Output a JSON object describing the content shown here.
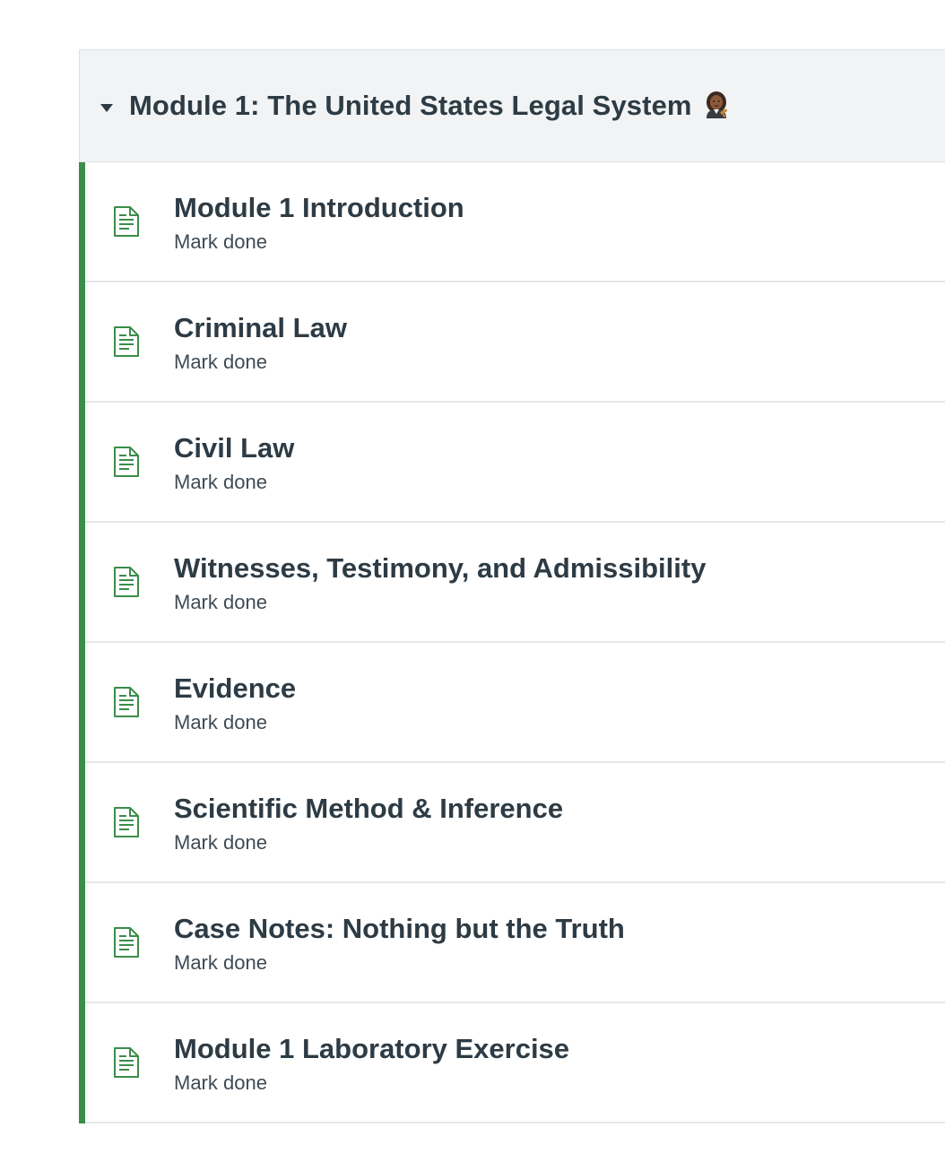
{
  "module": {
    "title": "Module 1: The United States Legal System",
    "emoji": "judge-woman-icon",
    "colors": {
      "accent": "#3b8d4a",
      "header_bg": "#f2f3f4",
      "text": "#2d3b45"
    },
    "items": [
      {
        "title": "Module 1 Introduction",
        "action": "Mark done",
        "icon": "page-icon"
      },
      {
        "title": "Criminal Law",
        "action": "Mark done",
        "icon": "page-icon"
      },
      {
        "title": "Civil Law",
        "action": "Mark done",
        "icon": "page-icon"
      },
      {
        "title": "Witnesses, Testimony, and Admissibility",
        "action": "Mark done",
        "icon": "page-icon"
      },
      {
        "title": "Evidence",
        "action": "Mark done",
        "icon": "page-icon"
      },
      {
        "title": "Scientific Method & Inference",
        "action": "Mark done",
        "icon": "page-icon"
      },
      {
        "title": "Case Notes: Nothing but the Truth",
        "action": "Mark done",
        "icon": "page-icon"
      },
      {
        "title": "Module 1 Laboratory Exercise",
        "action": "Mark done",
        "icon": "page-icon"
      }
    ]
  }
}
